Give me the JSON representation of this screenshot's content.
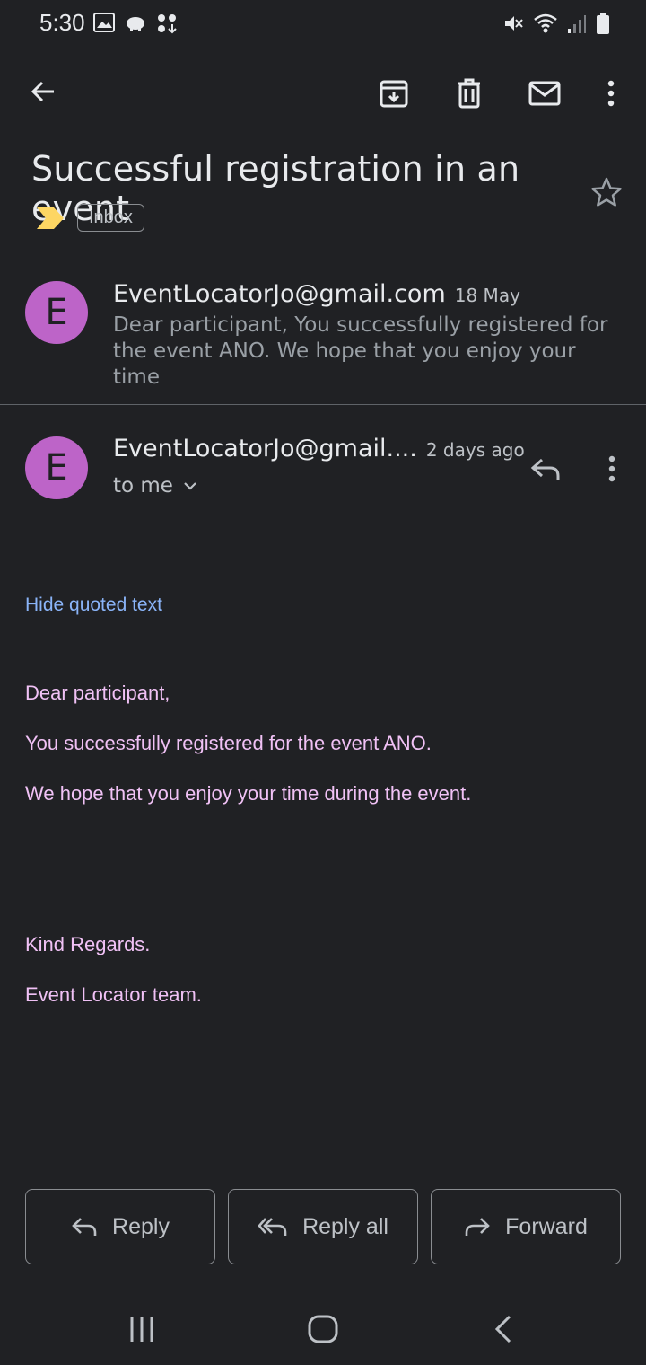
{
  "status_bar": {
    "time": "5:30"
  },
  "toolbar": {
    "back_icon": "arrow-left-icon",
    "archive_icon": "archive-icon",
    "delete_icon": "trash-icon",
    "mark_unread_icon": "mail-icon",
    "more_icon": "more-vert-icon"
  },
  "thread": {
    "subject": "Successful registration in an event",
    "label": "Inbox",
    "important_color": "#fdd663"
  },
  "collapsed_message": {
    "avatar_letter": "E",
    "sender": "EventLocatorJo@gmail.com",
    "date": "18 May",
    "snippet": "Dear participant, You successfully registered for the event ANO. We hope that you enjoy your time"
  },
  "expanded_message": {
    "avatar_letter": "E",
    "sender": "EventLocatorJo@gmail....",
    "date": "2 days ago",
    "to": "to me",
    "hide_quoted": "Hide quoted text",
    "body_lines": [
      "Dear participant,",
      "You successfully registered for the event ANO.",
      "We hope that you enjoy your time during the event.",
      "",
      "",
      "Kind Regards.",
      "Event Locator team."
    ]
  },
  "actions": {
    "reply": "Reply",
    "reply_all": "Reply all",
    "forward": "Forward"
  },
  "colors": {
    "background": "#202124",
    "avatar": "#bd64c8",
    "link": "#8ab4f8",
    "body_text": "#f0c1f5"
  }
}
